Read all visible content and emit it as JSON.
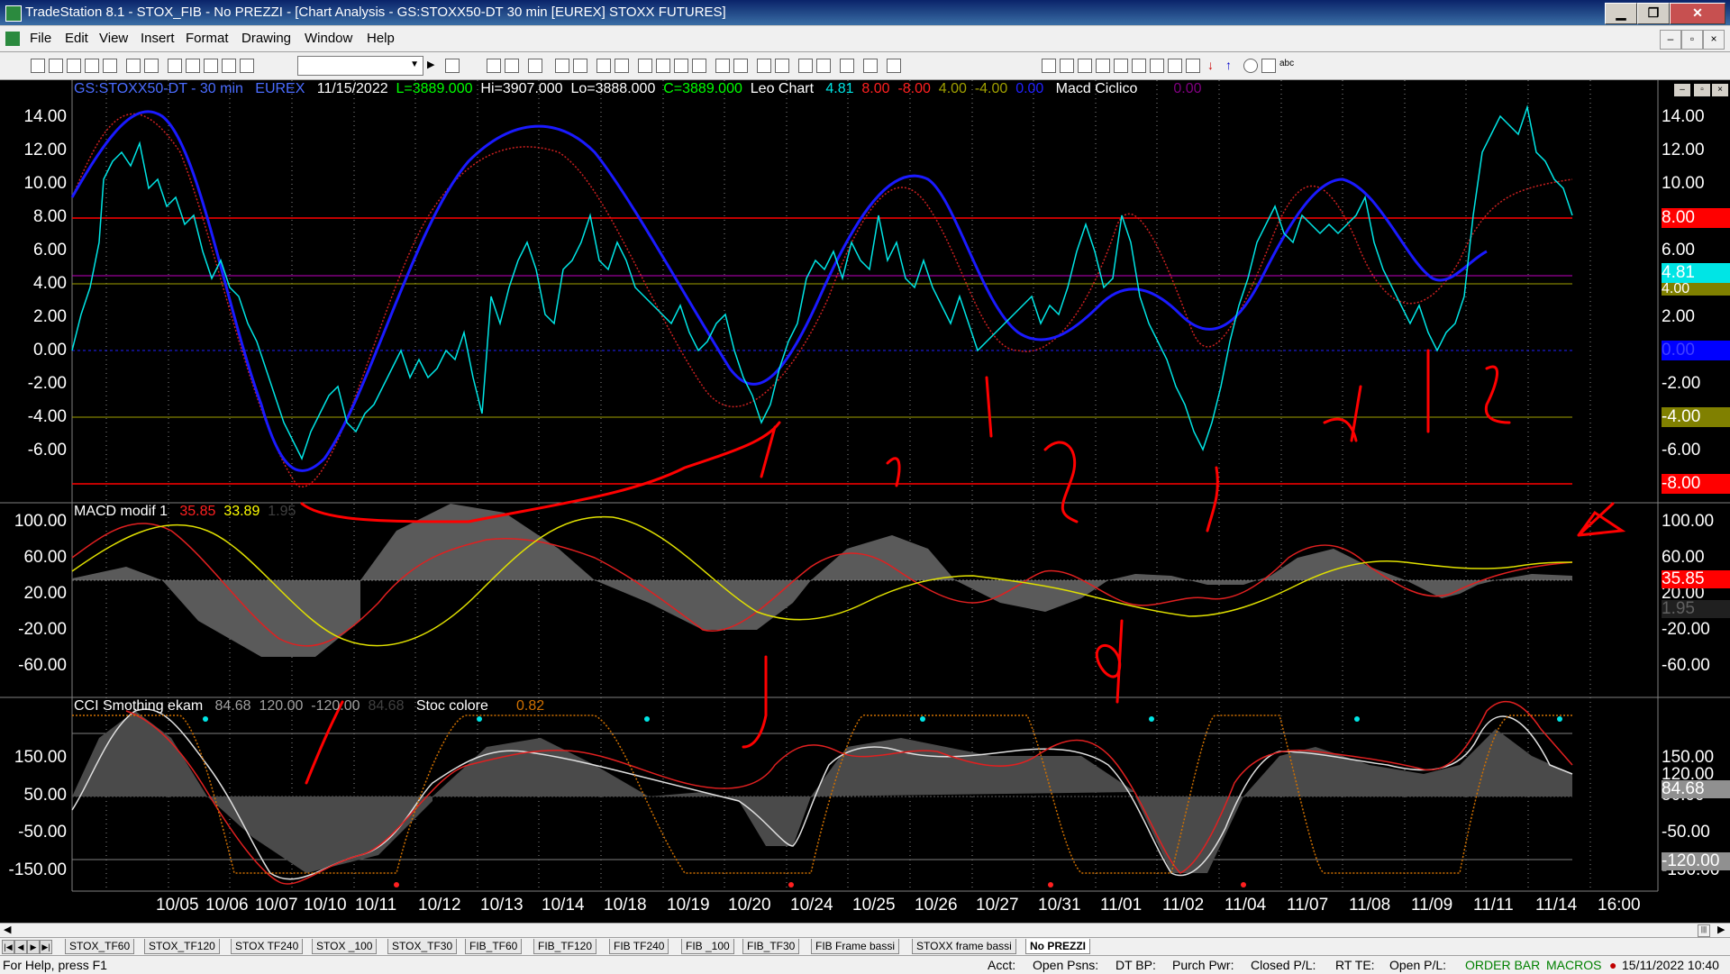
{
  "window": {
    "title": "TradeStation 8.1 - STOX_FIB - No PREZZI - [Chart Analysis - GS:STOXX50-DT  30 min  [EUREX] STOXX FUTURES]",
    "min": "▁",
    "max": "❐",
    "close": "✕"
  },
  "menu": [
    "File",
    "Edit",
    "View",
    "Insert",
    "Format",
    "Drawing",
    "Window",
    "Help"
  ],
  "header": {
    "symbol": "GS:STOXX50-DT - 30 min",
    "exchange": "EUREX",
    "date": "11/15/2022",
    "last": "L=3889.000",
    "hi": "Hi=3907.000",
    "lo": "Lo=3888.000",
    "close": "C=3889.000",
    "study": "Leo Chart",
    "v1": "4.81",
    "v2": "8.00",
    "v3": "-8.00",
    "v4": "4.00",
    "v5": "-4.00",
    "v6": "0.00",
    "study2": "Macd Ciclico",
    "v7": "0.00"
  },
  "panel2": {
    "name": "MACD modif 1",
    "v1": "35.85",
    "v2": "33.89",
    "v3": "1.95"
  },
  "panel3": {
    "name": "CCI Smothing ekam",
    "v1": "84.68",
    "v2": "120.00",
    "v3": "-120.00",
    "v4": "84.68",
    "name2": "Stoc colore",
    "v5": "0.82"
  },
  "axis1": [
    "14.00",
    "12.00",
    "10.00",
    "8.00",
    "6.00",
    "4.00",
    "2.00",
    "0.00",
    "-2.00",
    "-4.00",
    "-6.00"
  ],
  "axis2": [
    "100.00",
    "60.00",
    "20.00",
    "-20.00",
    "-60.00"
  ],
  "axis3": [
    "150.00",
    "50.00",
    "-50.00",
    "-150.00"
  ],
  "right1": [
    "14.00",
    "12.00",
    "10.00",
    "6.00",
    "2.00",
    "-2.00",
    "-6.00"
  ],
  "right2": [
    "100.00",
    "60.00",
    "20.00",
    "-20.00",
    "-60.00"
  ],
  "right3": [
    "150.00",
    "120.00",
    "50.00",
    "-50.00",
    "-150.00"
  ],
  "tags1": {
    "t8": "8.00",
    "t481": "4.81",
    "t4": "4.00",
    "t0": "0.00",
    "tm4": "-4.00",
    "tm8": "-8.00"
  },
  "tags2": {
    "t3585": "35.85",
    "t195": "1.95"
  },
  "tags3": {
    "t8468": "84.68",
    "tm120": "-120.00"
  },
  "xaxis": [
    "10/05",
    "10/06",
    "10/07",
    "10/10",
    "10/11",
    "10/12",
    "10/13",
    "10/14",
    "10/18",
    "10/19",
    "10/20",
    "10/24",
    "10/25",
    "10/26",
    "10/27",
    "10/31",
    "11/01",
    "11/02",
    "11/04",
    "11/07",
    "11/08",
    "11/09",
    "11/11",
    "11/14",
    "16:00"
  ],
  "tabs": [
    "STOX_TF60",
    "STOX_TF120",
    "STOX TF240",
    "STOX _100",
    "STOX_TF30",
    "FIB_TF60",
    "FIB_TF120",
    "FIB TF240",
    "FIB _100",
    "FIB_TF30",
    "FIB Frame bassi",
    "STOXX frame bassi",
    "No PREZZI"
  ],
  "status": {
    "help": "For Help, press F1",
    "acct": "Acct:",
    "open": "Open Psns:",
    "dtbp": "DT BP:",
    "purch": "Purch Pwr:",
    "closed": "Closed P/L:",
    "rtte": "RT TE:",
    "openpl": "Open P/L:",
    "orderbar": "ORDER BAR",
    "macros": "MACROS",
    "datetime": "15/11/2022 10:40"
  },
  "colors": {
    "cyan": "#00e5e5",
    "blue": "#1a1aff",
    "red": "#ff0000",
    "yellow": "#ffff00",
    "olive": "#808000"
  }
}
